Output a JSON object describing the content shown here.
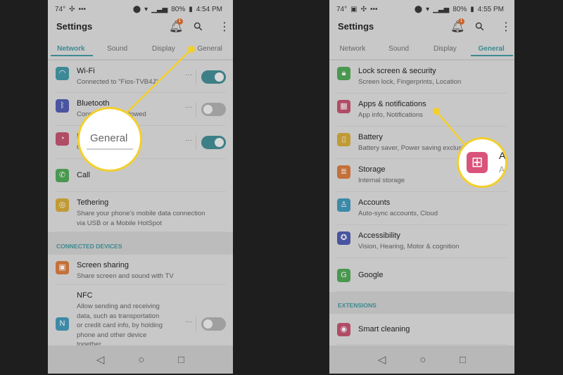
{
  "left": {
    "status": {
      "temp": "74°",
      "battery": "80%",
      "time": "4:54 PM"
    },
    "title": "Settings",
    "notif_count": "1",
    "tabs": [
      "Network",
      "Sound",
      "Display",
      "General"
    ],
    "active_tab": "Network",
    "items": [
      {
        "title": "Wi-Fi",
        "subtitle": "Connected to \"Fios-TVB4J\"",
        "icon": "wifi-icon",
        "color": "#3d8a96",
        "toggle": true
      },
      {
        "title": "Bluetooth",
        "subtitle": "Connection not allowed",
        "icon": "bluetooth-icon",
        "color": "#4a54a0",
        "toggle": false
      },
      {
        "title": "M",
        "subtitle": "C",
        "icon": "data-usage-icon",
        "color": "#b04c66",
        "toggle": true
      },
      {
        "title": "Call",
        "icon": "phone-icon",
        "color": "#4a9850"
      },
      {
        "title": "Tethering",
        "subtitle": "Share your phone's mobile data connection",
        "subtitle2": "via USB or a Mobile HotSpot",
        "icon": "hotspot-icon",
        "color": "#c09a35"
      }
    ],
    "section": "CONNECTED DEVICES",
    "items2": [
      {
        "title": "Screen sharing",
        "subtitle": "Share screen and sound with TV",
        "icon": "screen-share-icon",
        "color": "#c3703a"
      },
      {
        "title": "NFC",
        "lines": [
          "Allow sending and receiving",
          "data, such as transportation",
          "or credit card info, by holding",
          "phone and other device",
          "together"
        ],
        "icon": "nfc-icon",
        "color": "#3d8aa8",
        "toggle": false
      }
    ],
    "callout": "General"
  },
  "right": {
    "status": {
      "temp": "74°",
      "battery": "80%",
      "time": "4:55 PM"
    },
    "title": "Settings",
    "notif_count": "1",
    "tabs": [
      "Network",
      "Sound",
      "Display",
      "General"
    ],
    "active_tab": "General",
    "items": [
      {
        "title": "Lock screen & security",
        "subtitle": "Screen lock, Fingerprints, Location",
        "icon": "lock-icon",
        "color": "#4a9850"
      },
      {
        "title": "Apps & notifications",
        "subtitle": "App info, Notifications",
        "icon": "apps-grid-icon",
        "color": "#b04c66"
      },
      {
        "title": "Battery",
        "subtitle": "Battery saver, Power saving exclusions",
        "icon": "battery-icon",
        "color": "#c09a35"
      },
      {
        "title": "Storage",
        "subtitle": "Internal storage",
        "icon": "storage-icon",
        "color": "#c3703a"
      },
      {
        "title": "Accounts",
        "subtitle": "Auto-sync accounts, Cloud",
        "icon": "account-icon",
        "color": "#3d8aa8"
      },
      {
        "title": "Accessibility",
        "subtitle": "Vision, Hearing, Motor & cognition",
        "icon": "accessibility-icon",
        "color": "#4a54a0"
      },
      {
        "title": "Google",
        "icon": "google-icon",
        "color": "#4a9850"
      }
    ],
    "section": "EXTENSIONS",
    "items2": [
      {
        "title": "Smart cleaning",
        "icon": "smart-cleaning-icon",
        "color": "#b04c66"
      }
    ],
    "callout_letters": [
      "A",
      "A"
    ],
    "callout_icon_color": "#d9537a"
  },
  "colors": {
    "accent": "#3d8a91",
    "callout": "#f3cf2b"
  }
}
